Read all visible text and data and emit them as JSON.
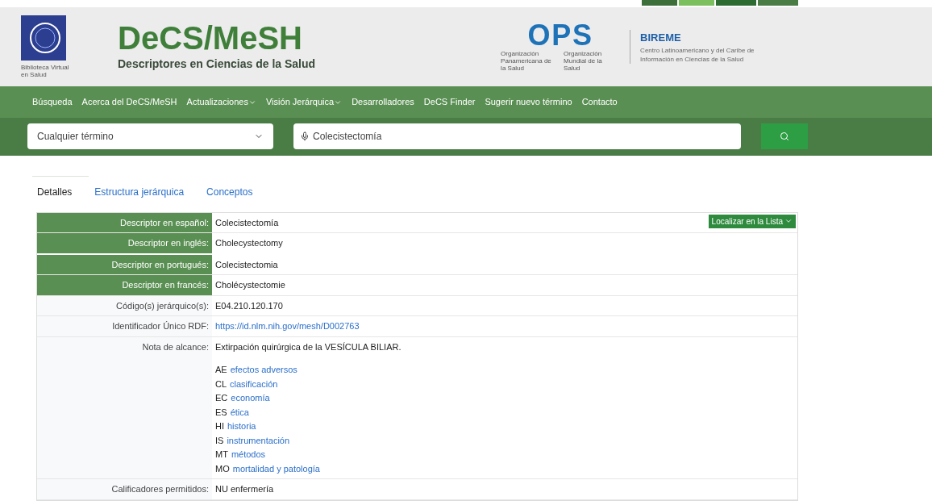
{
  "header": {
    "logo_caption": "Biblioteca Virtual en Salud",
    "title": "DeCS/MeSH",
    "subtitle": "Descriptores en Ciencias de la Salud",
    "ops": {
      "name": "OPS",
      "lines": [
        "Organización Panamericana de la Salud",
        "Organización Mundial de la Salud"
      ]
    },
    "bireme": {
      "name": "BIREME",
      "description": "Centro Latinoamericano y del Caribe de Información en Ciencias de la Salud"
    }
  },
  "nav": [
    {
      "label": "Búsqueda",
      "dropdown": false
    },
    {
      "label": "Acerca del DeCS/MeSH",
      "dropdown": false
    },
    {
      "label": "Actualizaciones",
      "dropdown": true
    },
    {
      "label": "Visión Jerárquica",
      "dropdown": true
    },
    {
      "label": "Desarrolladores",
      "dropdown": false
    },
    {
      "label": "DeCS Finder",
      "dropdown": false
    },
    {
      "label": "Sugerir nuevo término",
      "dropdown": false
    },
    {
      "label": "Contacto",
      "dropdown": false
    }
  ],
  "search": {
    "filter": "Cualquier término",
    "value": "Colecistectomía"
  },
  "tabs": [
    {
      "label": "Detalles",
      "selected": true
    },
    {
      "label": "Estructura jerárquica",
      "selected": false
    },
    {
      "label": "Conceptos",
      "selected": false
    }
  ],
  "action_button": "Localizar en la Lista",
  "details": [
    {
      "label": "Descriptor en español:",
      "kind": "highlight",
      "value": "Colecistectomía"
    },
    {
      "label": "Descriptor en inglés:",
      "kind": "highlight",
      "value": "Cholecystectomy"
    },
    {
      "label": "Descriptor en portugués:",
      "kind": "highlight",
      "value": "Colecistectomia"
    },
    {
      "label": "Descriptor en francés:",
      "kind": "highlight",
      "value": "Cholécystectomie"
    },
    {
      "label": "Código(s) jerárquico(s):",
      "kind": "text",
      "value": "E04.210.120.170"
    },
    {
      "label": "Identificador Único RDF:",
      "kind": "link",
      "value": "https://id.nlm.nih.gov/mesh/D002763"
    },
    {
      "label": "Nota de alcance:",
      "kind": "list",
      "value": "Extirpación quirúrgica de la VESÍCULA BILIAR.",
      "items": [
        {
          "code": "AE",
          "name": "efectos adversos"
        },
        {
          "code": "CL",
          "name": "clasificación"
        },
        {
          "code": "EC",
          "name": "economía"
        },
        {
          "code": "ES",
          "name": "ética"
        },
        {
          "code": "HI",
          "name": "historia"
        },
        {
          "code": "IS",
          "name": "instrumentación"
        },
        {
          "code": "MT",
          "name": "métodos"
        },
        {
          "code": "MO",
          "name": "mortalidad y patología"
        }
      ]
    },
    {
      "label": "Calificadores permitidos:",
      "kind": "text",
      "value": "NU enfermería"
    }
  ]
}
